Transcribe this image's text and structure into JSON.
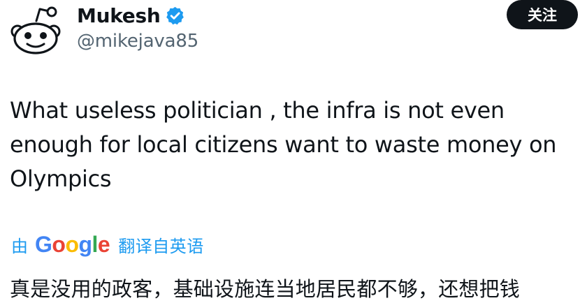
{
  "user": {
    "display_name": "Mukesh",
    "handle": "@mikejava85"
  },
  "follow_button": {
    "label": "关注"
  },
  "tweet": {
    "text": "What useless politician , the infra is not even enough for local citizens want to waste money on Olympics",
    "translated_text": "真是没用的政客，基础设施连当地居民都不够，还想把钱"
  },
  "translation": {
    "by_label": "由",
    "provider_letters": [
      "G",
      "o",
      "o",
      "g",
      "l",
      "e"
    ],
    "from_label": "翻译自英语"
  },
  "colors": {
    "verified": "#1d9bf0",
    "link": "#1d9bf0",
    "google_blue": "#4285f4",
    "google_red": "#ea4335",
    "google_yellow": "#fbbc05",
    "google_green": "#34a853"
  },
  "icons": {
    "avatar": "reddit-alien-avatar",
    "verified": "verified-badge-icon"
  }
}
